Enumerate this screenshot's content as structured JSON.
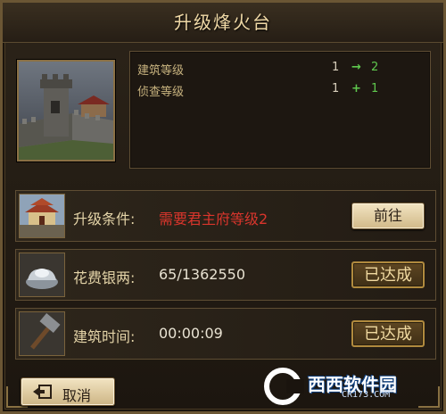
{
  "dialog": {
    "title": "升级烽火台"
  },
  "stats": [
    {
      "label": "建筑等级",
      "from": "1",
      "op": "→",
      "to": "2"
    },
    {
      "label": "侦查等级",
      "from": "1",
      "op": "+",
      "to": "1"
    }
  ],
  "requirements": [
    {
      "label": "升级条件:",
      "value": "需要君主府等级2",
      "button": "前往",
      "icon": "palace-icon"
    },
    {
      "label": "花费银两:",
      "value": "65/1362550",
      "button": "已达成",
      "icon": "silver-ingot-icon"
    },
    {
      "label": "建筑时间:",
      "value": "00:00:09",
      "button": "已达成",
      "icon": "hammer-icon"
    }
  ],
  "footer": {
    "cancel_label": "取消"
  },
  "watermark": {
    "brand": "西西软件园",
    "url": "CR173.COM"
  },
  "colors": {
    "condition_red": "#d9352c",
    "upgrade_green": "#5fc84e",
    "gold_border": "#8a7044"
  }
}
